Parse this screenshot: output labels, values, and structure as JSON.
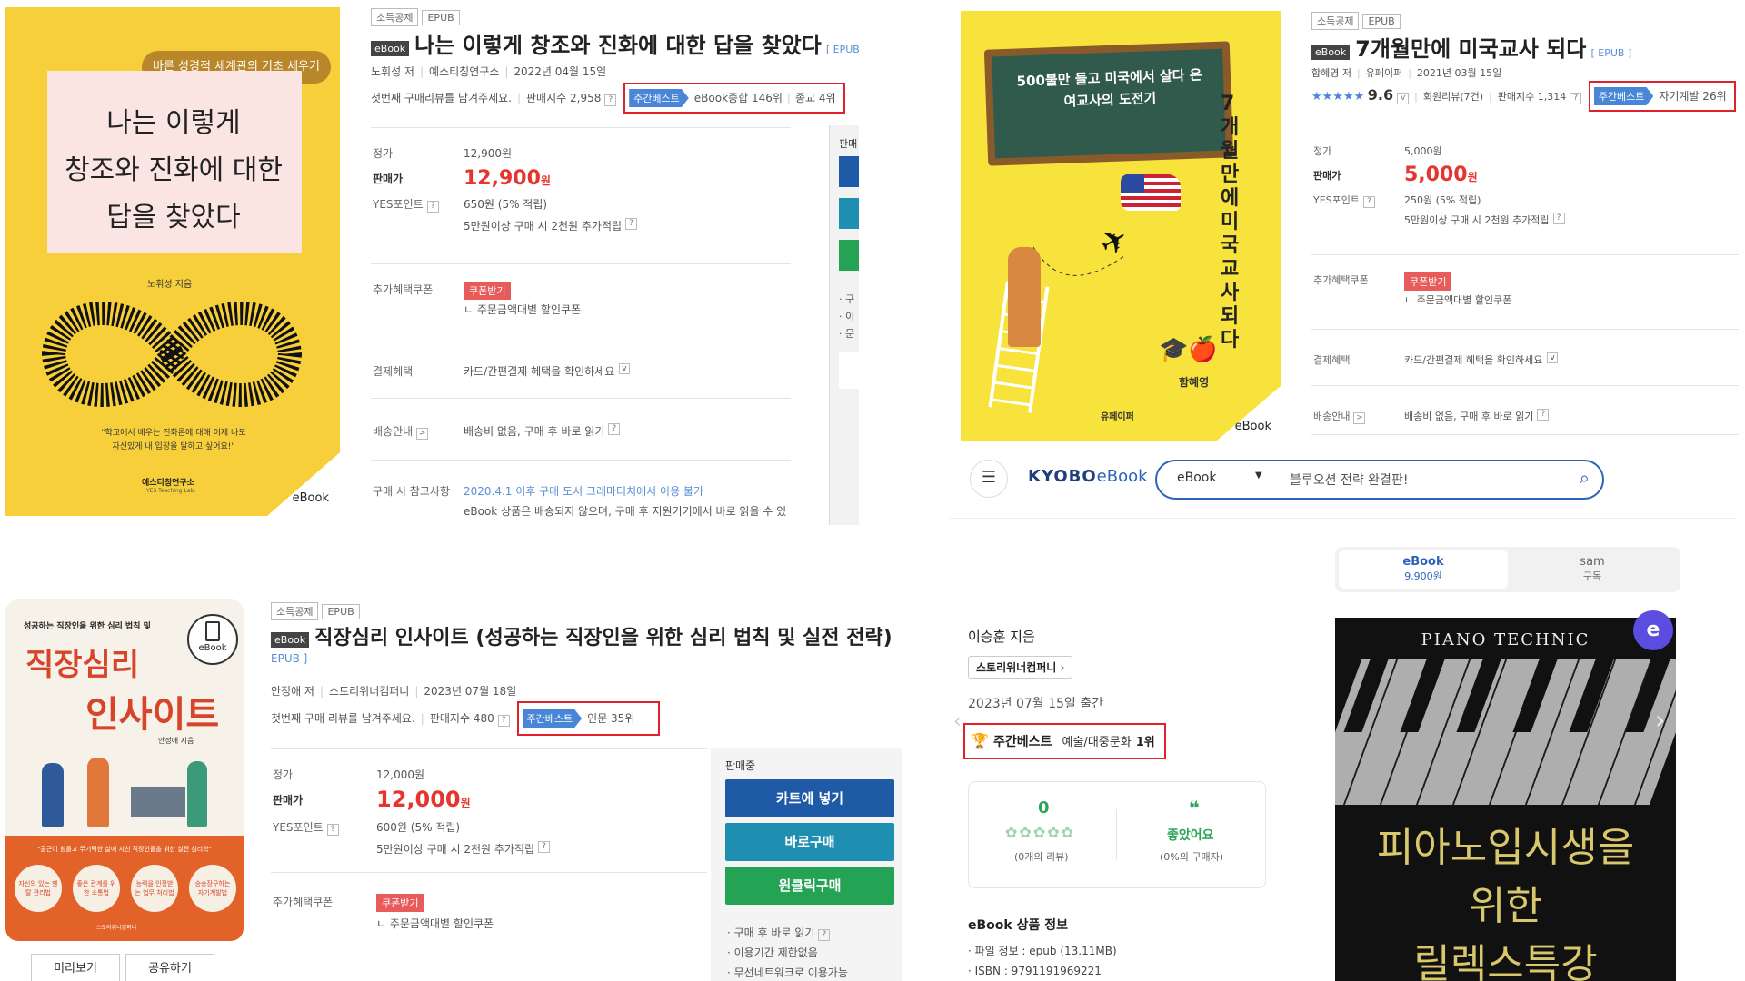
{
  "p1": {
    "cover": {
      "banner": "바른 성경적 세계관의 기초 세우기",
      "title_lines": [
        "나는 이렇게",
        "창조와 진화에 대한",
        "답을 찾았다"
      ],
      "author_line": "노휘성 지음",
      "quote_1": "\"학교에서 배우는 진화론에 대해 이제 나도",
      "quote_2": "자신있게 내 입장을 말하고 싶어요!\"",
      "publisher": "예스티칭연구소",
      "publisher_en": "YES Teaching Lab.",
      "ebook_mark": "eBook"
    },
    "tags": [
      "소득공제",
      "EPUB"
    ],
    "badge": "eBook",
    "title": "나는 이렇게 창조와 진화에 대한 답을 찾았다",
    "format": "[ EPUB ]",
    "author": "노휘성 저",
    "publisher": "예스티칭연구소",
    "date": "2022년 04월 15일",
    "review_prompt": "첫번째 구매리뷰를 남겨주세요.",
    "sales_index": "판매지수 2,958",
    "best_flag": "주간베스트",
    "best_rank_1": "eBook종합 146위",
    "best_rank_2": "종교 4위",
    "labels": {
      "list": "정가",
      "sale": "판매가",
      "point": "YES포인트",
      "coupon": "추가혜택쿠폰",
      "payment": "결제혜택",
      "shipping": "배송안내",
      "note": "구매 시 참고사항"
    },
    "list_price": "12,900원",
    "sale_price": "12,900",
    "won": "원",
    "point": "650원 (5% 적립)",
    "point_extra": "5만원이상 구매 시 2천원 추가적립",
    "coupon_btn": "쿠폰받기",
    "coupon_desc": "ㄴ 주문금액대별 할인쿠폰",
    "payment": "카드/간편결제 혜택을 확인하세요",
    "shipping": "배송비 없음, 구매 후 바로 읽기",
    "note_1": "2020.4.1 이후 구매 도서 크레마터치에서 이용 불가",
    "note_2": "eBook 상품은 배송되지 않으며, 구매 후 지원기기에서 바로 읽을 수 있",
    "side_head": "판매",
    "side_list": [
      "· 구",
      "· 이",
      "· 문"
    ]
  },
  "p2": {
    "cover": {
      "board_1": "500불만 들고 미국에서 살다 온",
      "board_2": "여교사의 도전기",
      "vertical": "7개월만에 미국교사 되다",
      "author": "함혜영",
      "publisher": "유페이퍼",
      "ebook_mark": "eBook"
    },
    "tags": [
      "소득공제",
      "EPUB"
    ],
    "badge": "eBook",
    "title": "7개월만에 미국교사 되다",
    "format": "[ EPUB ]",
    "author": "함혜영 저",
    "publisher": "유페이퍼",
    "date": "2021년 03월 15일",
    "stars": "★★★★★",
    "rating": "9.6",
    "reviews": "회원리뷰(7건)",
    "sales_index": "판매지수 1,314",
    "best_flag": "주간베스트",
    "best_rank": "자기계발 26위",
    "labels": {
      "list": "정가",
      "sale": "판매가",
      "point": "YES포인트",
      "coupon": "추가혜택쿠폰",
      "payment": "결제혜택",
      "shipping": "배송안내"
    },
    "list_price": "5,000원",
    "sale_price": "5,000",
    "won": "원",
    "point": "250원 (5% 적립)",
    "point_extra": "5만원이상 구매 시 2천원 추가적립",
    "coupon_btn": "쿠폰받기",
    "coupon_desc": "ㄴ 주문금액대별 할인쿠폰",
    "payment": "카드/간편결제 혜택을 확인하세요",
    "shipping": "배송비 없음, 구매 후 바로 읽기"
  },
  "p3": {
    "cover": {
      "subtitle": "성공하는 직장인을 위한 심리 법칙 및",
      "title_1": "직장심리",
      "title_2": "인사이트",
      "author": "안정애 지음",
      "ebook_mark": "eBook",
      "tagline": "\"출근이 힘들고 무기력한 삶에 지친 직장인들을 위한 실전 심리학\"",
      "circles": [
        "자신의 있는 멘탈 관리법",
        "좋은 관계를 위한 소통법",
        "능력을 인정받는 업무 처리법",
        "승승장구하는 자기계발법"
      ],
      "publisher": "스토리위너컴퍼니"
    },
    "tags": [
      "소득공제",
      "EPUB"
    ],
    "badge": "eBook",
    "title": "직장심리 인사이트 (성공하는 직장인을 위한 심리 법칙 및 실전 전략)",
    "format": "EPUB ]",
    "author": "안정애 저",
    "publisher": "스토리위너컴퍼니",
    "date": "2023년 07월 18일",
    "review_prompt": "첫번째 구매 리뷰를 남겨주세요.",
    "sales_index": "판매지수 480",
    "best_flag": "주간베스트",
    "best_rank": "인문 35위",
    "labels": {
      "list": "정가",
      "sale": "판매가",
      "point": "YES포인트",
      "coupon": "추가혜택쿠폰"
    },
    "list_price": "12,000원",
    "sale_price": "12,000",
    "won": "원",
    "point": "600원 (5% 적립)",
    "point_extra": "5만원이상 구매 시 2천원 추가적립",
    "coupon_btn": "쿠폰받기",
    "coupon_desc": "ㄴ 주문금액대별 할인쿠폰",
    "side_head": "판매중",
    "btn_cart": "카트에 넣기",
    "btn_buy": "바로구매",
    "btn_oneclick": "원클릭구매",
    "side_list": [
      "· 구매 후 바로 읽기",
      "· 이용기간 제한없음",
      "· 무선네트워크로 이용가능"
    ],
    "btn_preview": "미리보기",
    "btn_share": "공유하기"
  },
  "p4": {
    "logo_1": "KYOBO",
    "logo_2": "eBook",
    "search_category": "eBook",
    "search_value": "블루오션 전략 완결판!",
    "author": "이승훈 지음",
    "publisher": "스토리위너컴퍼니",
    "pub_date": "2023년 07월 15일 출간",
    "best_label": "주간베스트",
    "best_rank_cat": "예술/대중문화",
    "best_rank_num": "1위",
    "review_count": "0",
    "review_sub": "(0개의 리뷰)",
    "like_label": "좋았어요",
    "like_sub": "(0%의 구매자)",
    "info_head": "eBook 상품 정보",
    "file_info": "파일 정보 : epub (13.11MB)",
    "isbn": "ISBN : 9791191969221",
    "tab_ebook": "eBook",
    "tab_ebook_price": "9,900원",
    "tab_sam": "sam",
    "tab_sam_sub": "구독",
    "cover_top": "PIANO TECHNIC",
    "cover_title": [
      "피아노입시생을",
      "위한",
      "릴렉스특강"
    ],
    "cover_badge": "e"
  },
  "colors": {
    "red_outline": "#e0202a",
    "best_blue": "#4a86d8",
    "price_red": "#e4362f",
    "yes_blue": "#1f5aa6",
    "yes_teal": "#1e8fb0",
    "yes_green": "#24a354",
    "cover_yellow": "#f7cf3b",
    "kyobo_blue": "#2d62b8"
  }
}
